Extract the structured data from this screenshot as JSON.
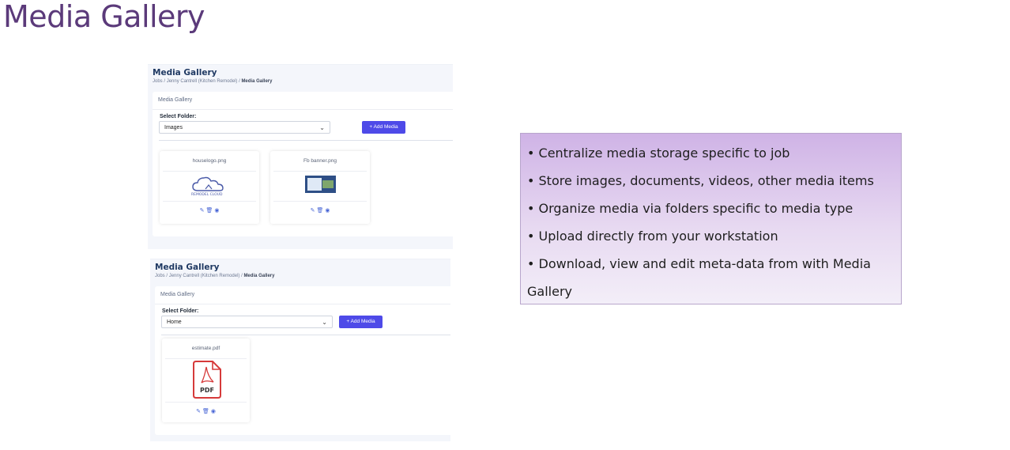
{
  "slide": {
    "title": "Media Gallery"
  },
  "screenshots": [
    {
      "title": "Media Gallery",
      "breadcrumb": {
        "jobs": "Jobs",
        "job": "Jenny Cantrell (Kitchen Remodel)",
        "current": "Media Gallery"
      },
      "card_header": "Media Gallery",
      "folder_label": "Select Folder:",
      "folder_value": "Images",
      "add_button": "+ Add Media",
      "tiles": [
        {
          "name": "houselogo.png",
          "logo_text": "REMODEL CLOUD"
        },
        {
          "name": "Fb banner.png"
        }
      ]
    },
    {
      "title": "Media Gallery",
      "breadcrumb": {
        "jobs": "Jobs",
        "job": "Jenny Cantrell (Kitchen Remodel)",
        "current": "Media Gallery"
      },
      "card_header": "Media Gallery",
      "folder_label": "Select Folder:",
      "folder_value": "Home",
      "add_button": "+ Add Media",
      "tiles": [
        {
          "name": "estimate.pdf",
          "pdf_label": "PDF"
        }
      ]
    }
  ],
  "info": {
    "bullets": [
      "• Centralize media storage specific to job",
      "• Store images, documents, videos, other media items",
      "• Organize media via folders specific to media type",
      "• Upload directly from your workstation",
      "• Download, view and edit meta-data from with Media",
      "Gallery"
    ]
  },
  "colors": {
    "title": "#5b3a7a",
    "accent": "#4e4ae8",
    "info_bg_top": "#cfb3e6"
  },
  "icons": {
    "edit": "pencil-icon",
    "delete": "trash-icon",
    "view": "eye-icon"
  }
}
